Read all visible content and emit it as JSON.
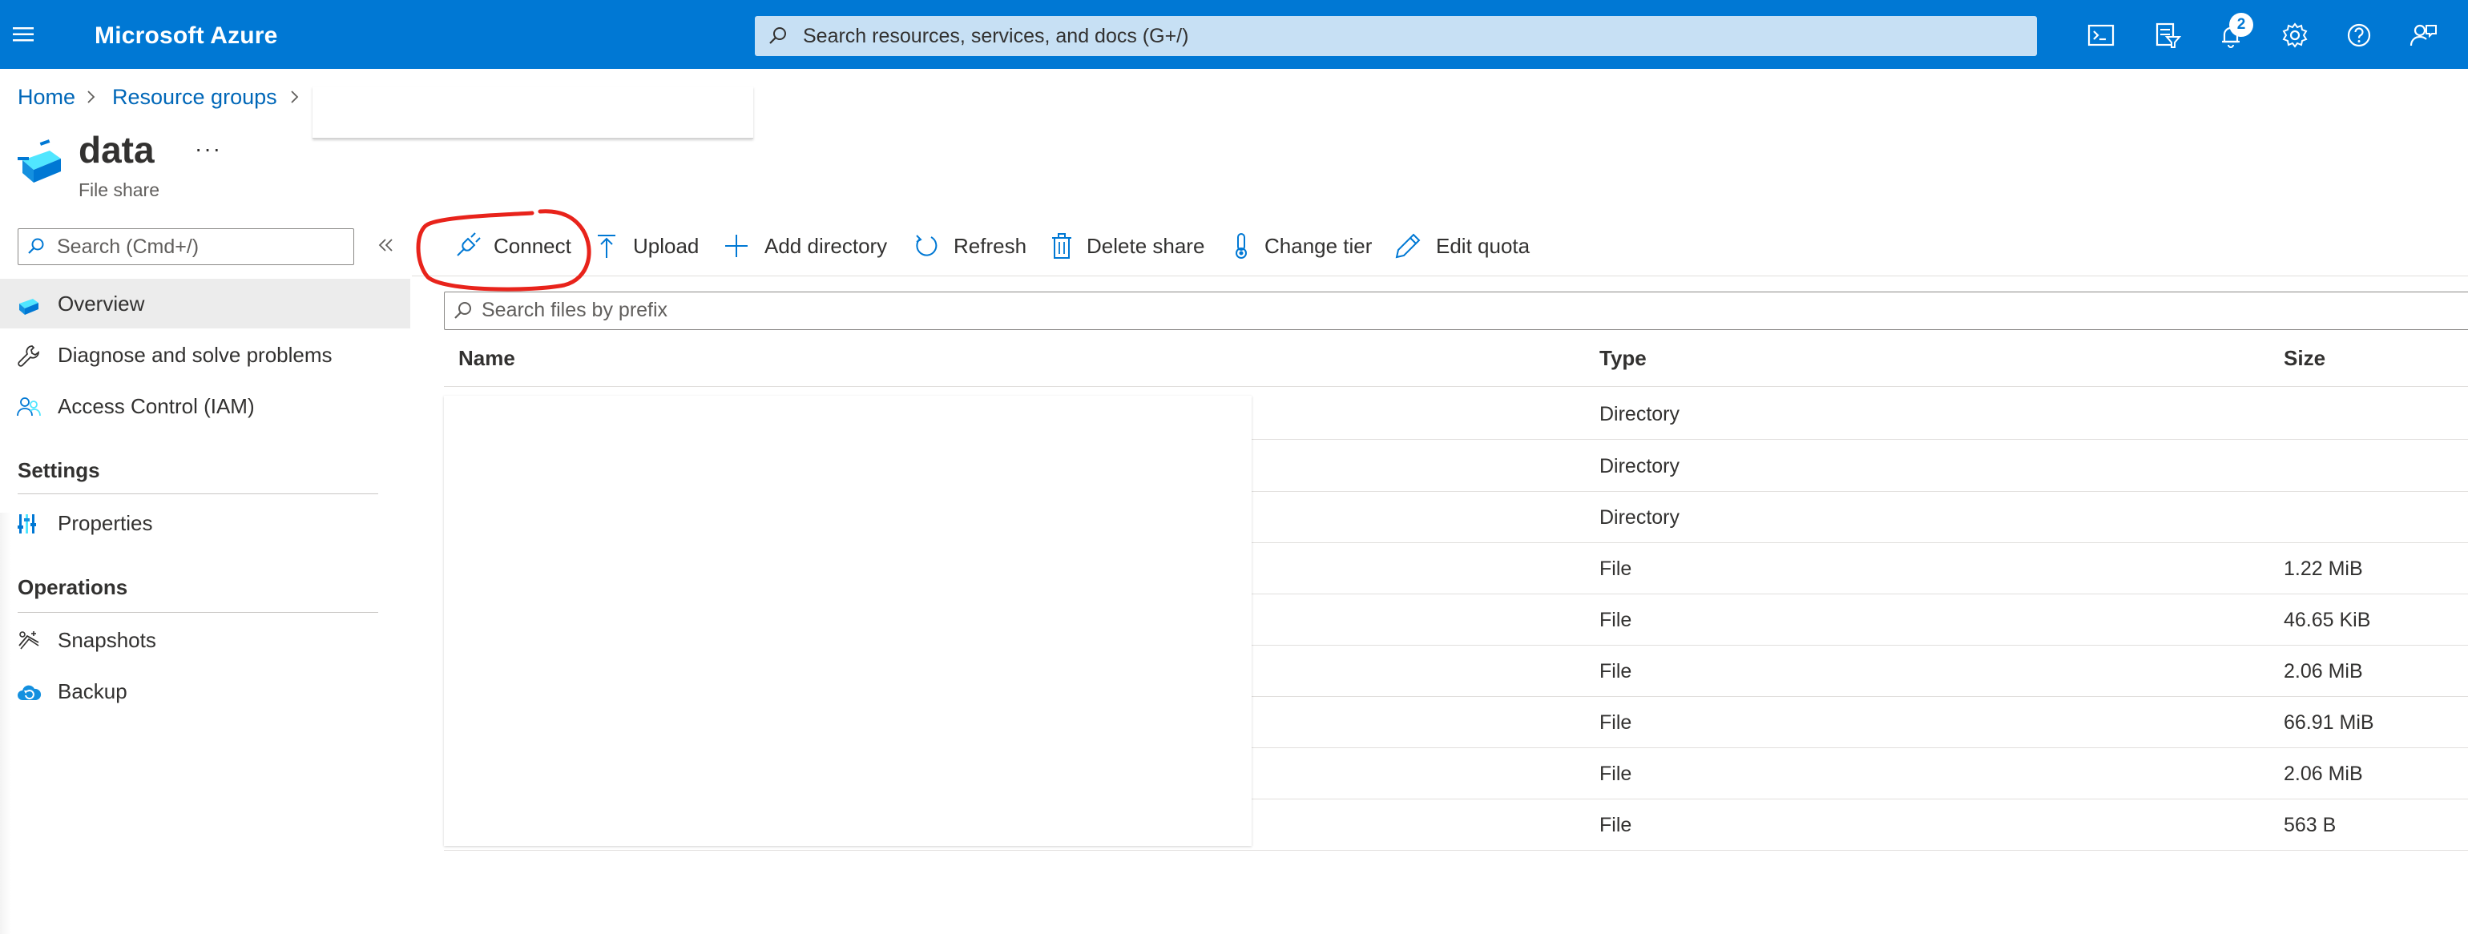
{
  "topbar": {
    "brand": "Microsoft Azure",
    "search_placeholder": "Search resources, services, and docs (G+/)",
    "notification_count": "2"
  },
  "breadcrumb": [
    {
      "label": "Home"
    },
    {
      "label": "Resource groups"
    }
  ],
  "resource": {
    "title": "data",
    "subtitle": "File share",
    "more": "···"
  },
  "nav": {
    "search_placeholder": "Search (Cmd+/)",
    "items": [
      {
        "label": "Overview",
        "icon": "file-share-icon"
      },
      {
        "label": "Diagnose and solve problems",
        "icon": "wrench-icon"
      },
      {
        "label": "Access Control (IAM)",
        "icon": "people-icon"
      }
    ],
    "sections": [
      {
        "header": "Settings",
        "items": [
          {
            "label": "Properties",
            "icon": "properties-icon"
          }
        ]
      },
      {
        "header": "Operations",
        "items": [
          {
            "label": "Snapshots",
            "icon": "snapshots-icon"
          },
          {
            "label": "Backup",
            "icon": "backup-cloud-icon"
          }
        ]
      }
    ]
  },
  "commands": [
    {
      "label": "Connect",
      "icon": "plug-icon"
    },
    {
      "label": "Upload",
      "icon": "upload-arrow-icon"
    },
    {
      "label": "Add directory",
      "icon": "plus-icon"
    },
    {
      "label": "Refresh",
      "icon": "refresh-icon"
    },
    {
      "label": "Delete share",
      "icon": "trash-icon"
    },
    {
      "label": "Change tier",
      "icon": "thermometer-icon"
    },
    {
      "label": "Edit quota",
      "icon": "pencil-icon"
    }
  ],
  "files": {
    "search_placeholder": "Search files by prefix",
    "columns": [
      "Name",
      "Type",
      "Size"
    ],
    "rows": [
      {
        "type": "Directory",
        "size": ""
      },
      {
        "type": "Directory",
        "size": ""
      },
      {
        "type": "Directory",
        "size": ""
      },
      {
        "type": "File",
        "size": "1.22 MiB"
      },
      {
        "type": "File",
        "size": "46.65 KiB"
      },
      {
        "type": "File",
        "size": "2.06 MiB"
      },
      {
        "type": "File",
        "size": "66.91 MiB"
      },
      {
        "type": "File",
        "size": "2.06 MiB"
      },
      {
        "type": "File",
        "size": "563 B"
      }
    ]
  },
  "colors": {
    "azure_blue": "#0078d4",
    "link_blue": "#0067b8",
    "annotation_red": "#e8231b"
  }
}
